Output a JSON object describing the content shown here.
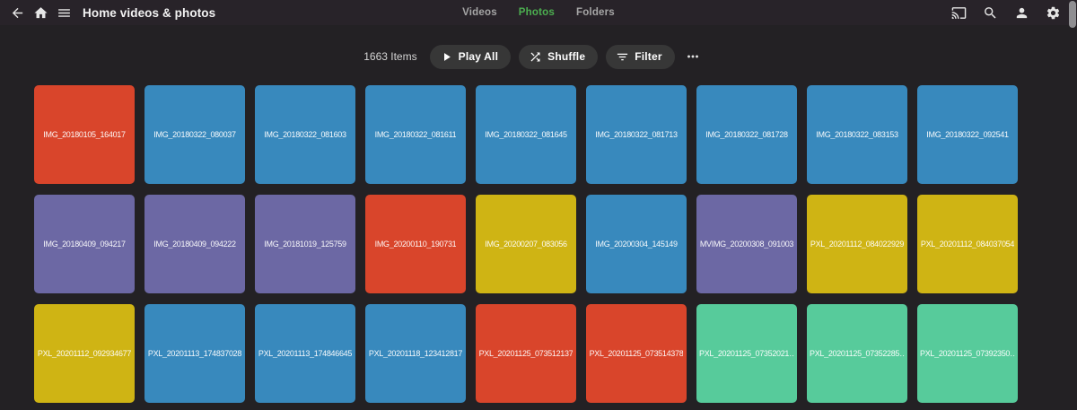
{
  "topbar": {
    "title": "Home videos & photos",
    "tabs": [
      {
        "label": "Videos",
        "active": false
      },
      {
        "label": "Photos",
        "active": true
      },
      {
        "label": "Folders",
        "active": false
      }
    ],
    "icons_left": [
      "arrow-back-icon",
      "home-icon",
      "hamburger-menu-icon"
    ],
    "icons_right": [
      "cast-icon",
      "search-icon",
      "user-icon",
      "settings-gear-icon"
    ]
  },
  "toolbar": {
    "items_count": "1663 Items",
    "play_all_label": "Play All",
    "shuffle_label": "Shuffle",
    "filter_label": "Filter",
    "more_icon": "more-horizontal-icon"
  },
  "colors": {
    "accent_green": "#4caf50",
    "topbar_bg": "#282329",
    "page_bg": "#232124",
    "button_bg": "#373737",
    "tile_palette": {
      "red": "#d9452b",
      "blue": "#3889bd",
      "purple": "#6c68a4",
      "yellow": "#cfb414",
      "teal": "#57cb9b"
    }
  },
  "grid": {
    "tiles": [
      {
        "label": "IMG_20180105_164017",
        "color": "red"
      },
      {
        "label": "IMG_20180322_080037",
        "color": "blue"
      },
      {
        "label": "IMG_20180322_081603",
        "color": "blue"
      },
      {
        "label": "IMG_20180322_081611",
        "color": "blue"
      },
      {
        "label": "IMG_20180322_081645",
        "color": "blue"
      },
      {
        "label": "IMG_20180322_081713",
        "color": "blue"
      },
      {
        "label": "IMG_20180322_081728",
        "color": "blue"
      },
      {
        "label": "IMG_20180322_083153",
        "color": "blue"
      },
      {
        "label": "IMG_20180322_092541",
        "color": "blue"
      },
      {
        "label": "IMG_20180409_094217",
        "color": "purple"
      },
      {
        "label": "IMG_20180409_094222",
        "color": "purple"
      },
      {
        "label": "IMG_20181019_125759",
        "color": "purple"
      },
      {
        "label": "IMG_20200110_190731",
        "color": "red"
      },
      {
        "label": "IMG_20200207_083056",
        "color": "yellow"
      },
      {
        "label": "IMG_20200304_145149",
        "color": "blue"
      },
      {
        "label": "MVIMG_20200308_091003",
        "color": "purple"
      },
      {
        "label": "PXL_20201112_084022929",
        "color": "yellow"
      },
      {
        "label": "PXL_20201112_084037054",
        "color": "yellow"
      },
      {
        "label": "PXL_20201112_092934677",
        "color": "yellow"
      },
      {
        "label": "PXL_20201113_174837028",
        "color": "blue"
      },
      {
        "label": "PXL_20201113_174846645",
        "color": "blue"
      },
      {
        "label": "PXL_20201118_123412817",
        "color": "blue"
      },
      {
        "label": "PXL_20201125_073512137",
        "color": "red"
      },
      {
        "label": "PXL_20201125_073514378",
        "color": "red"
      },
      {
        "label": "PXL_20201125_07352021…",
        "color": "teal"
      },
      {
        "label": "PXL_20201125_07352285…",
        "color": "teal"
      },
      {
        "label": "PXL_20201125_07392350…",
        "color": "teal"
      }
    ]
  }
}
